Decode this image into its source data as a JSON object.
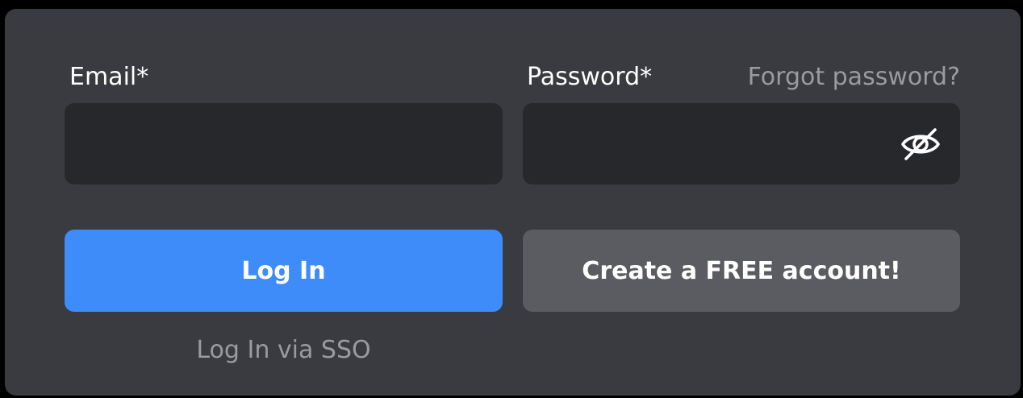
{
  "form": {
    "email": {
      "label": "Email*",
      "value": "",
      "placeholder": ""
    },
    "password": {
      "label": "Password*",
      "value": "",
      "placeholder": "",
      "forgot_label": "Forgot password?",
      "toggle_icon": "eye-slash-icon"
    },
    "login_label": "Log In",
    "create_account_label": "Create a FREE account!",
    "sso_label": "Log In via SSO"
  },
  "colors": {
    "panel": "#3a3b40",
    "field": "#27282c",
    "primary": "#3d8cf9",
    "secondary": "#5b5c61",
    "muted_text": "#9a9ba1"
  }
}
